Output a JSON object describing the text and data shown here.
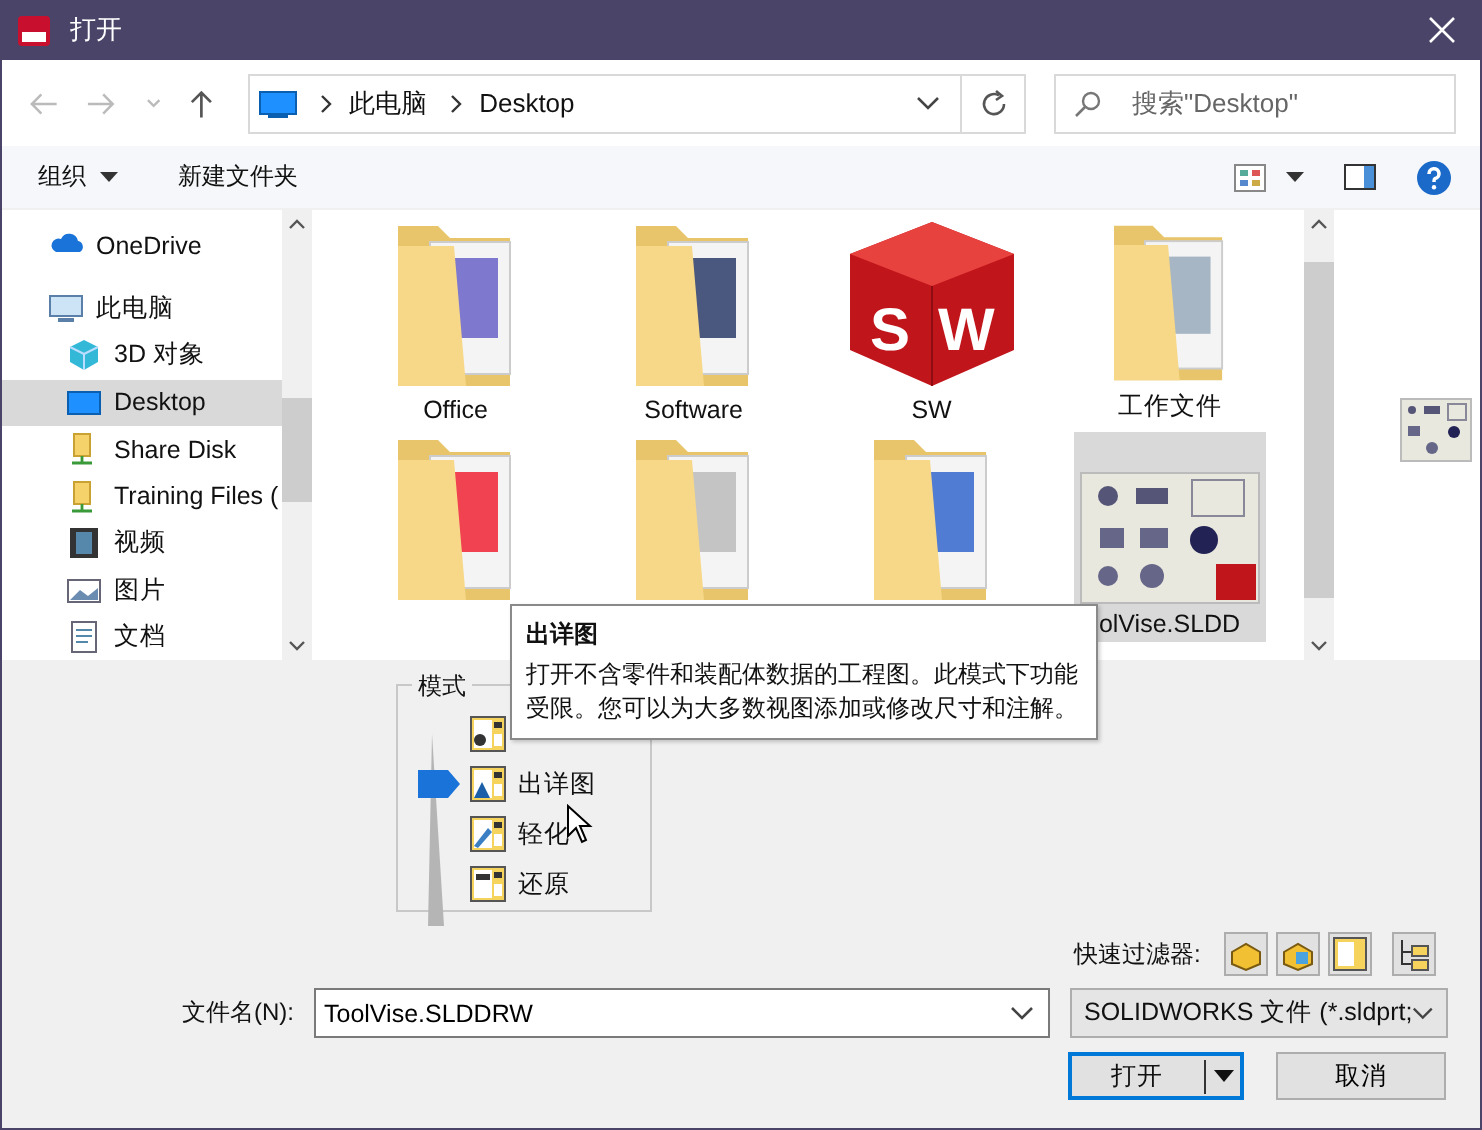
{
  "window": {
    "title": "打开"
  },
  "address": {
    "path": [
      "此电脑",
      "Desktop"
    ]
  },
  "search": {
    "placeholder": "搜索\"Desktop\""
  },
  "toolbar": {
    "organize": "组织",
    "new_folder": "新建文件夹"
  },
  "sidebar": {
    "items": [
      {
        "label": "OneDrive",
        "kind": "cloud",
        "selected": false
      },
      {
        "label": "此电脑",
        "kind": "pc",
        "selected": false,
        "children": [
          {
            "label": "3D 对象",
            "kind": "cube",
            "selected": false
          },
          {
            "label": "Desktop",
            "kind": "desktop",
            "selected": true
          },
          {
            "label": "Share Disk",
            "kind": "share",
            "selected": false
          },
          {
            "label": "Training Files (",
            "kind": "share",
            "selected": false
          },
          {
            "label": "视频",
            "kind": "video",
            "selected": false
          },
          {
            "label": "图片",
            "kind": "picture",
            "selected": false
          },
          {
            "label": "文档",
            "kind": "document",
            "selected": false
          }
        ]
      }
    ]
  },
  "files": [
    {
      "name": "Office",
      "kind": "folder",
      "selected": false
    },
    {
      "name": "Software",
      "kind": "folder",
      "selected": false
    },
    {
      "name": "SW",
      "kind": "app",
      "logo_letters": [
        "S",
        "W"
      ],
      "selected": false
    },
    {
      "name": "工作文件",
      "kind": "folder",
      "selected": false
    },
    {
      "kind": "folder",
      "selected": false
    },
    {
      "kind": "folder",
      "selected": false
    },
    {
      "kind": "folder",
      "selected": false
    },
    {
      "name": "olVise.SLDD",
      "kind": "drawing",
      "selected": true
    }
  ],
  "tooltip": {
    "title": "出详图",
    "text": "打开不含零件和装配体数据的工程图。此模式下功能受限。您可以为大多数视图添加或修改尺寸和注解。"
  },
  "mode": {
    "title": "模式",
    "items": [
      {
        "kind": "review",
        "selected": false
      },
      {
        "label": "出详图",
        "kind": "detail",
        "selected": true
      },
      {
        "label": "轻化",
        "kind": "light",
        "selected": false
      },
      {
        "label": "还原",
        "kind": "resolve",
        "selected": false
      }
    ]
  },
  "quick_filter": {
    "label": "快速过滤器:"
  },
  "file_name": {
    "label": "文件名(N):",
    "value": "ToolVise.SLDDRW"
  },
  "file_type": {
    "value": "SOLIDWORKS 文件 (*.sldprt;"
  },
  "buttons": {
    "open": "打开",
    "cancel": "取消"
  }
}
